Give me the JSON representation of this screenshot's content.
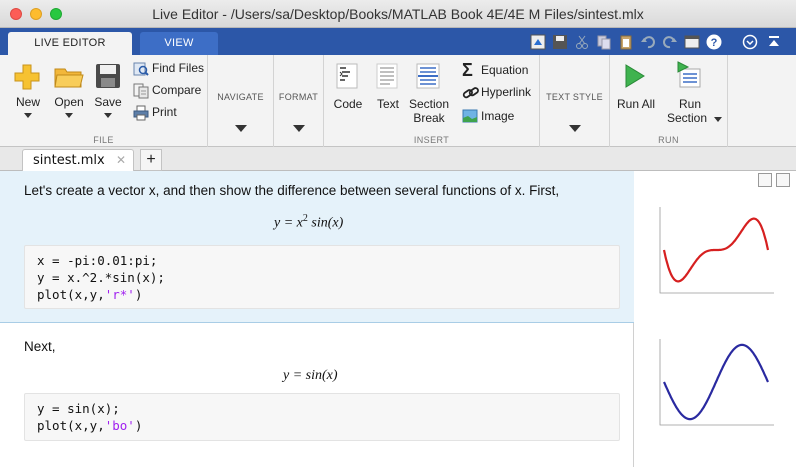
{
  "window": {
    "title": "Live Editor - /Users/sa/Desktop/Books/MATLAB Book 4E/4E M Files/sintest.mlx"
  },
  "ribbon_tabs": [
    {
      "label": "LIVE EDITOR",
      "active": true
    },
    {
      "label": "VIEW",
      "active": false
    }
  ],
  "file_group": {
    "label": "FILE",
    "new": "New",
    "open": "Open",
    "save": "Save",
    "find_files": "Find Files",
    "compare": "Compare",
    "print": "Print"
  },
  "navigate_group": {
    "label": "NAVIGATE"
  },
  "format_group": {
    "label": "FORMAT"
  },
  "insert_group": {
    "label": "INSERT",
    "code": "Code",
    "text": "Text",
    "section_break_1": "Section",
    "section_break_2": "Break",
    "equation": "Equation",
    "hyperlink": "Hyperlink",
    "image": "Image"
  },
  "text_style_group": {
    "label": "TEXT STYLE"
  },
  "run_group": {
    "label": "RUN",
    "run_all": "Run All",
    "run_section_1": "Run",
    "run_section_2": "Section"
  },
  "doc_tab": {
    "label": "sintest.mlx",
    "close": "✕",
    "add": "+"
  },
  "section1": {
    "text": "Let's create a vector x, and then show the difference between several functions of x.  First,",
    "equation": {
      "lhs": "y = x",
      "exponent": "2",
      "rhs": " sin(x)"
    },
    "code": [
      {
        "pre": "x = -pi:0.01:pi;",
        "str": "",
        "post": ""
      },
      {
        "pre": "y = x.^2.*sin(x);",
        "str": "",
        "post": ""
      },
      {
        "pre": "plot(x,y,",
        "str": "'r*'",
        "post": ")"
      }
    ]
  },
  "section2": {
    "text": "Next,",
    "equation": "y = sin(x)",
    "code": [
      {
        "pre": "y = sin(x);",
        "str": "",
        "post": ""
      },
      {
        "pre": "plot(x,y,",
        "str": "'bo'",
        "post": ")"
      }
    ]
  },
  "output": {
    "plot1": {
      "color": "#d62020",
      "function": "x^2*sin(x)"
    },
    "plot2": {
      "color": "#2a2aa0",
      "function": "sin(x)"
    }
  },
  "colors": {
    "ribbon_blue": "#2c57a8",
    "section_highlight": "#e5f2fa",
    "string_purple": "#a020f0"
  }
}
